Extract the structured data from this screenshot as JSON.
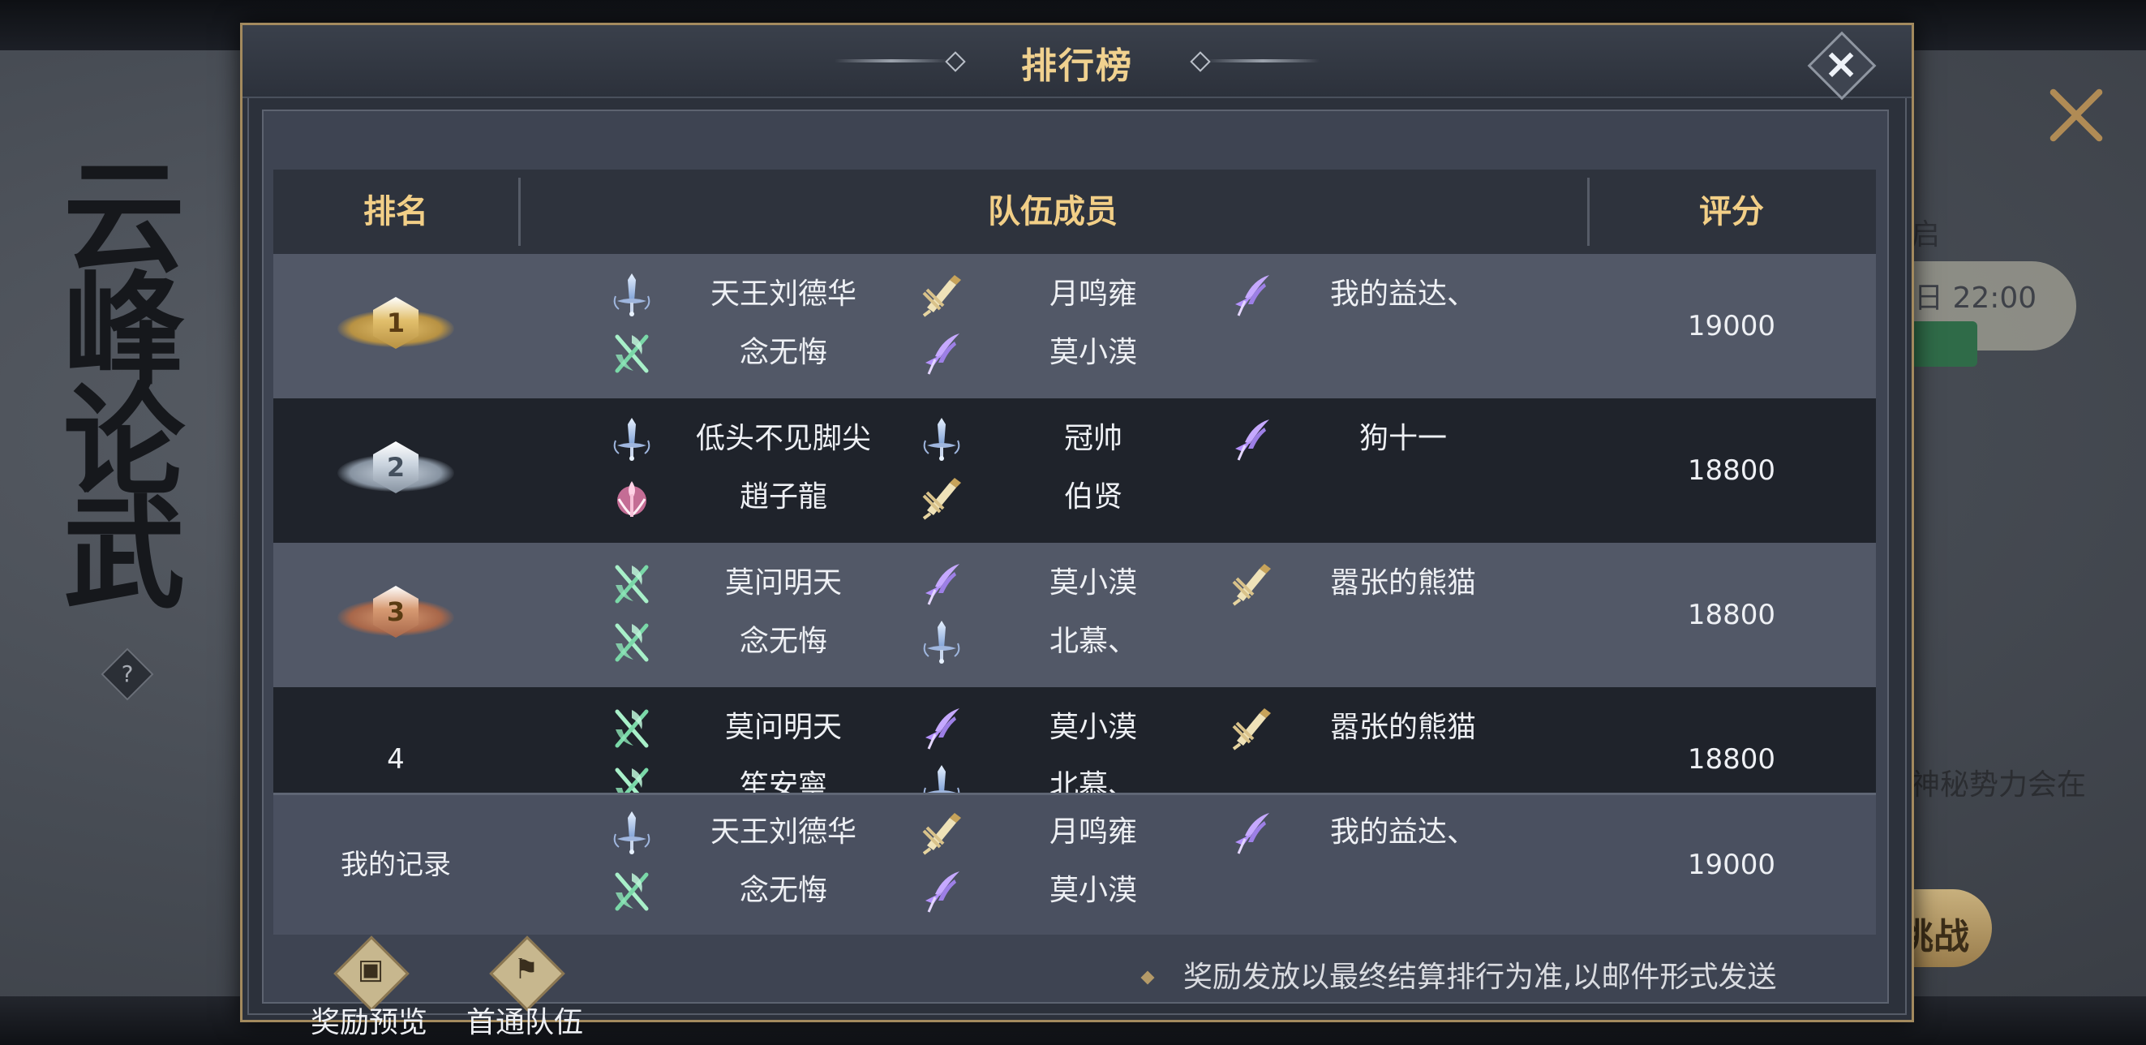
{
  "background": {
    "calligraphy": [
      "云",
      "峰",
      "论",
      "武"
    ],
    "help_label": "?",
    "partial_texts": [
      "启",
      "日 22:00",
      "神秘势力会在",
      "挑战"
    ]
  },
  "dialog": {
    "title": "排行榜",
    "close_label": "×"
  },
  "table": {
    "headers": {
      "rank": "排名",
      "team": "队伍成员",
      "score": "评分"
    },
    "rows": [
      {
        "rank_label": "1",
        "medal": "gold",
        "score": "19000",
        "members": [
          {
            "name": "天王刘德华",
            "icon": "sword"
          },
          {
            "name": "月鸣雍",
            "icon": "scroll-brush"
          },
          {
            "name": "我的益达、",
            "icon": "feather-blade"
          },
          {
            "name": "念无悔",
            "icon": "twin-blades"
          },
          {
            "name": "莫小漠",
            "icon": "feather-blade"
          }
        ]
      },
      {
        "rank_label": "2",
        "medal": "silver",
        "score": "18800",
        "members": [
          {
            "name": "低头不见脚尖",
            "icon": "sword"
          },
          {
            "name": "冠帅",
            "icon": "sword"
          },
          {
            "name": "狗十一",
            "icon": "feather-blade"
          },
          {
            "name": "趙子龍",
            "icon": "lotus-staff"
          },
          {
            "name": "伯贤",
            "icon": "scroll-brush"
          }
        ]
      },
      {
        "rank_label": "3",
        "medal": "bronze",
        "score": "18800",
        "members": [
          {
            "name": "莫问明天",
            "icon": "twin-blades"
          },
          {
            "name": "莫小漠",
            "icon": "feather-blade"
          },
          {
            "name": "嚣张的熊猫",
            "icon": "scroll-brush"
          },
          {
            "name": "念无悔",
            "icon": "twin-blades"
          },
          {
            "name": "北慕、",
            "icon": "sword"
          }
        ]
      },
      {
        "rank_label": "4",
        "medal": "",
        "score": "18800",
        "members": [
          {
            "name": "莫问明天",
            "icon": "twin-blades"
          },
          {
            "name": "莫小漠",
            "icon": "feather-blade"
          },
          {
            "name": "嚣张的熊猫",
            "icon": "scroll-brush"
          },
          {
            "name": "笙安寧",
            "icon": "twin-blades"
          },
          {
            "name": "北慕、",
            "icon": "sword"
          }
        ]
      }
    ]
  },
  "my_record": {
    "label": "我的记录",
    "score": "19000",
    "members": [
      {
        "name": "天王刘德华",
        "icon": "sword"
      },
      {
        "name": "月鸣雍",
        "icon": "scroll-brush"
      },
      {
        "name": "我的益达、",
        "icon": "feather-blade"
      },
      {
        "name": "念无悔",
        "icon": "twin-blades"
      },
      {
        "name": "莫小漠",
        "icon": "feather-blade"
      }
    ]
  },
  "footer": {
    "reward_preview": "奖励预览",
    "first_clear_team": "首通队伍",
    "notice": "奖励发放以最终结算排行为准,以邮件形式发送"
  },
  "colors": {
    "accent_gold": "#f2cf87",
    "row_light": "#525867",
    "row_dark": "#1f232b",
    "medal_gold": "#e2bf6c",
    "medal_silver": "#c9d3de",
    "medal_bronze": "#d79a72"
  }
}
